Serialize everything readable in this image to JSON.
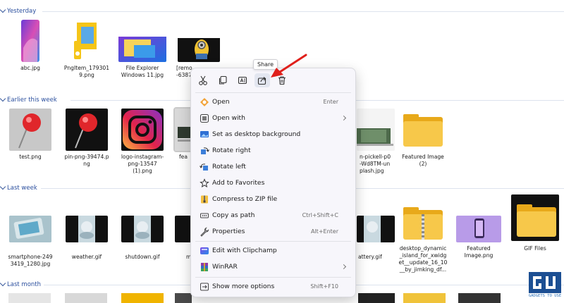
{
  "groups": [
    {
      "id": "yesterday",
      "title": "Yesterday"
    },
    {
      "id": "earlier",
      "title": "Earlier this week"
    },
    {
      "id": "lastweek",
      "title": "Last week"
    },
    {
      "id": "lastmonth",
      "title": "Last month"
    }
  ],
  "files": {
    "yesterday": [
      {
        "label": "abc.jpg",
        "icon": "wallpaper-thumbnail"
      },
      {
        "label": "PngItem_179301\n9.png",
        "icon": "file-explorer-logo-thumbnail"
      },
      {
        "label": "File Explorer\nWindows 11.jpg",
        "icon": "file-explorer-screenshot-thumbnail"
      },
      {
        "label": "[remo\n-6387",
        "icon": "minion-thumbnail"
      }
    ],
    "earlier": [
      {
        "label": "test.png",
        "icon": "red-pushpin-thumbnail"
      },
      {
        "label": "pin-png-39474.p\nng",
        "icon": "red-pushpin-thumbnail"
      },
      {
        "label": "logo-instagram-\npng-13547\n(1).png",
        "icon": "instagram-logo-thumbnail"
      },
      {
        "label": "fea",
        "icon": "selected-laptop-thumbnail"
      },
      {
        "label": "n-pickell-p0\n-Wd8TM-un\nplash.jpg",
        "icon": "laptop-plant-thumbnail"
      },
      {
        "label": "Featured Image\n(2)",
        "icon": "folder-icon"
      }
    ],
    "lastweek": [
      {
        "label": "smartphone-249\n3419_1280.jpg",
        "icon": "smartphone-thumbnail"
      },
      {
        "label": "weather.gif",
        "icon": "weather-thumbnail"
      },
      {
        "label": "shutdown.gif",
        "icon": "shutdown-thumbnail"
      },
      {
        "label": "m",
        "icon": "gif-thumbnail"
      },
      {
        "label": "attery.gif",
        "icon": "battery-thumbnail"
      },
      {
        "label": "desktop_dynamic\n_island_for_xwidg\net__update_16_10\n__by_jimking_df...",
        "icon": "zip-folder-icon"
      },
      {
        "label": "Featured\nImage.png",
        "icon": "featured-phone-thumbnail"
      },
      {
        "label": "GIF Files",
        "icon": "folder-icon"
      }
    ]
  },
  "context_menu": {
    "tooltip": "Share",
    "toolbar": [
      {
        "name": "cut-icon",
        "title": "Cut"
      },
      {
        "name": "copy-icon",
        "title": "Copy"
      },
      {
        "name": "rename-icon",
        "title": "Rename"
      },
      {
        "name": "share-icon",
        "title": "Share"
      },
      {
        "name": "delete-icon",
        "title": "Delete"
      }
    ],
    "items": [
      {
        "label": "Open",
        "shortcut": "Enter",
        "icon": "open-icon"
      },
      {
        "label": "Open with",
        "shortcut": "",
        "icon": "open-with-icon",
        "submenu": true
      },
      {
        "label": "Set as desktop background",
        "shortcut": "",
        "icon": "desktop-background-icon"
      },
      {
        "label": "Rotate right",
        "shortcut": "",
        "icon": "rotate-right-icon"
      },
      {
        "label": "Rotate left",
        "shortcut": "",
        "icon": "rotate-left-icon"
      },
      {
        "label": "Add to Favorites",
        "shortcut": "",
        "icon": "star-icon"
      },
      {
        "label": "Compress to ZIP file",
        "shortcut": "",
        "icon": "zip-icon"
      },
      {
        "label": "Copy as path",
        "shortcut": "Ctrl+Shift+C",
        "icon": "copy-path-icon"
      },
      {
        "label": "Properties",
        "shortcut": "Alt+Enter",
        "icon": "properties-icon"
      },
      {
        "label": "Edit with Clipchamp",
        "shortcut": "",
        "icon": "clipchamp-icon"
      },
      {
        "label": "WinRAR",
        "shortcut": "",
        "icon": "winrar-icon",
        "submenu": true
      },
      {
        "label": "Show more options",
        "shortcut": "Shift+F10",
        "icon": "more-options-icon"
      }
    ]
  },
  "watermark": {
    "text": "GADGETS TO USE"
  },
  "colors": {
    "accent": "#2b4f9e",
    "annotation_arrow": "#e0201b",
    "folder": "#f7c84a"
  }
}
